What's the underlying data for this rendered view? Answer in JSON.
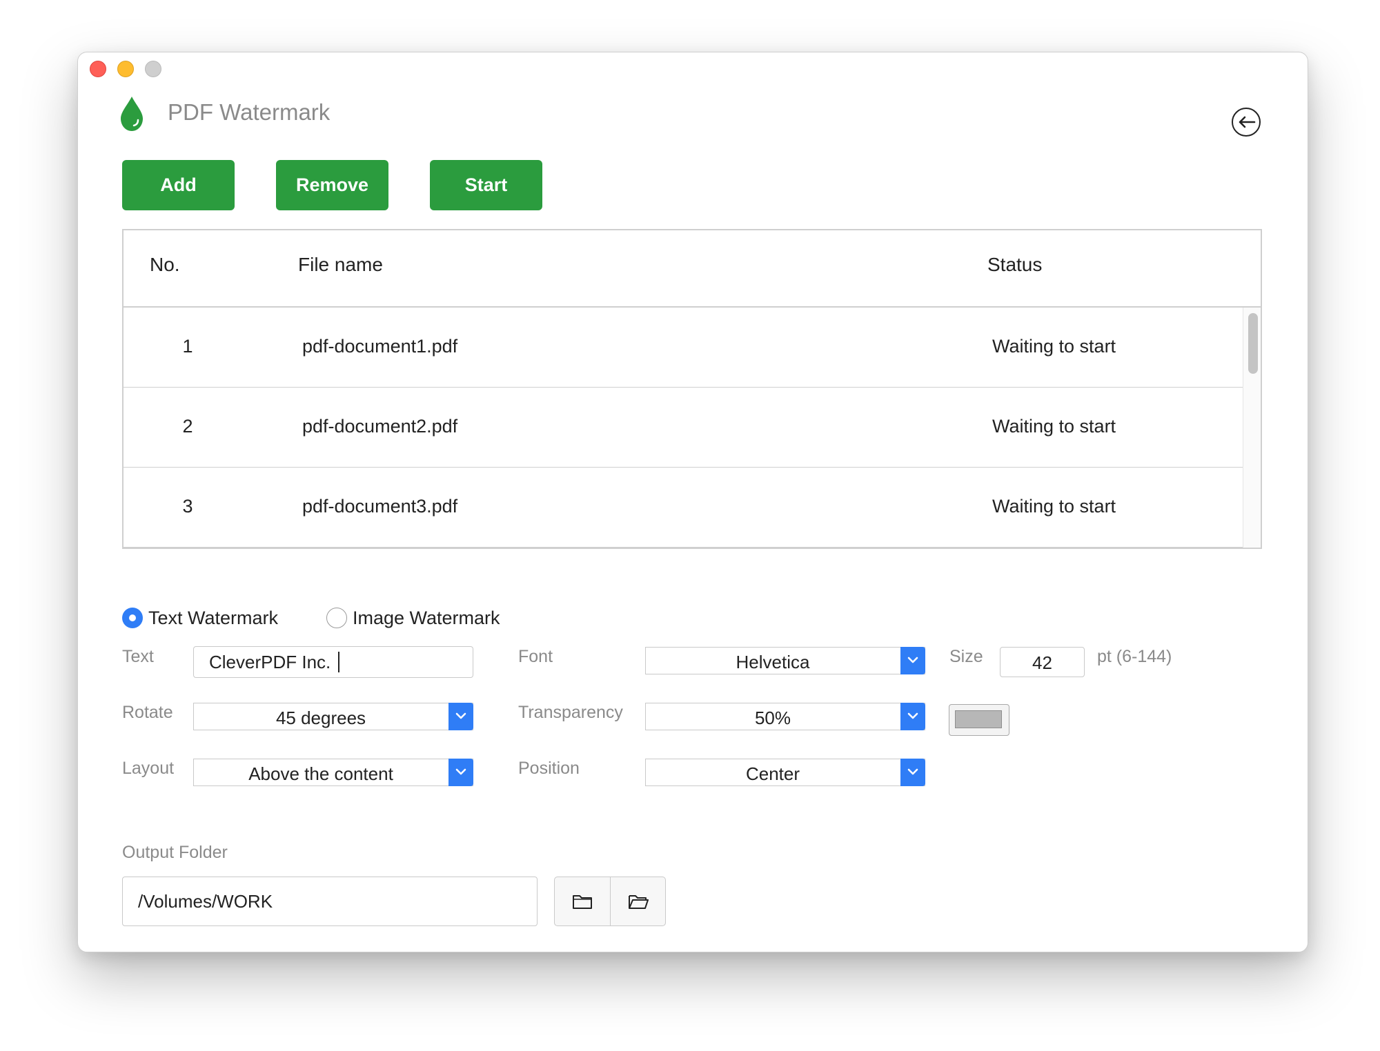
{
  "app": {
    "title": "PDF Watermark"
  },
  "toolbar": {
    "add_label": "Add",
    "remove_label": "Remove",
    "start_label": "Start"
  },
  "table": {
    "headers": {
      "no": "No.",
      "file": "File name",
      "status": "Status"
    },
    "rows": [
      {
        "no": "1",
        "file": "pdf-document1.pdf",
        "status": "Waiting to start"
      },
      {
        "no": "2",
        "file": "pdf-document2.pdf",
        "status": "Waiting to start"
      },
      {
        "no": "3",
        "file": "pdf-document3.pdf",
        "status": "Waiting to start"
      }
    ]
  },
  "watermark": {
    "mode_text_label": "Text Watermark",
    "mode_image_label": "Image Watermark",
    "selected_mode": "text",
    "text_label": "Text",
    "text_value": "CleverPDF Inc.",
    "font_label": "Font",
    "font_value": "Helvetica",
    "size_label": "Size",
    "size_value": "42",
    "size_range": "pt (6-144)",
    "rotate_label": "Rotate",
    "rotate_value": "45 degrees",
    "transparency_label": "Transparency",
    "transparency_value": "50%",
    "color_value": "#b7b7b7",
    "layout_label": "Layout",
    "layout_value": "Above the content",
    "position_label": "Position",
    "position_value": "Center"
  },
  "output": {
    "label": "Output Folder",
    "path": "/Volumes/WORK"
  },
  "icons": {
    "logo": "water-drop-icon",
    "back": "back-arrow-icon",
    "folder": "folder-icon",
    "open_folder": "folder-open-icon",
    "dropdown": "chevron-down-icon"
  },
  "colors": {
    "accent_green": "#2b9c3e",
    "accent_blue": "#2f7df6"
  }
}
